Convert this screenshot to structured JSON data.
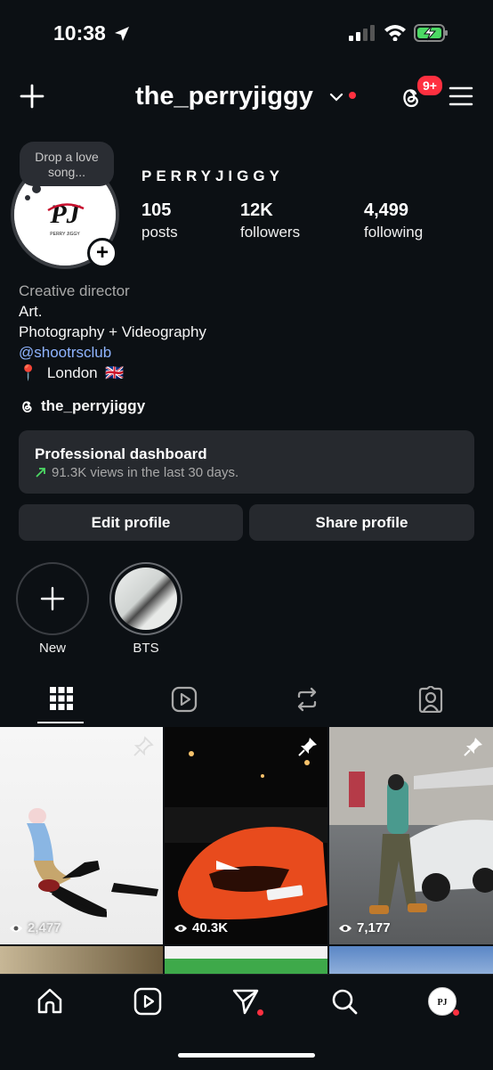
{
  "status_bar": {
    "time": "10:38"
  },
  "header": {
    "username": "the_perryjiggy",
    "notification_badge": "9+"
  },
  "profile": {
    "note": "Drop a love song...",
    "display_name": "PERRYJIGGY",
    "avatar_logo_text": "PJ",
    "avatar_logo_sub": "PERRY JIGGY",
    "stats": [
      {
        "value": "105",
        "label": "posts"
      },
      {
        "value": "12K",
        "label": "followers"
      },
      {
        "value": "4,499",
        "label": "following"
      }
    ],
    "bio": {
      "category": "Creative director",
      "line1": "Art.",
      "line2": "Photography + Videography",
      "mention": "@shootrsclub",
      "location": "London",
      "location_pin": "📍",
      "location_flag": "🇬🇧"
    },
    "threads_handle": "the_perryjiggy"
  },
  "dashboard": {
    "title": "Professional dashboard",
    "subtitle": "91.3K views in the last 30 days."
  },
  "buttons": {
    "edit": "Edit profile",
    "share": "Share profile"
  },
  "highlights": [
    {
      "label": "New"
    },
    {
      "label": "BTS"
    }
  ],
  "tabs": [
    "grid-icon",
    "reels-icon",
    "reposts-icon",
    "tagged-icon"
  ],
  "posts": [
    {
      "views": "2,477",
      "pinned": true
    },
    {
      "views": "40.3K",
      "pinned": true
    },
    {
      "views": "7,177",
      "pinned": true
    }
  ],
  "nav": [
    "home-icon",
    "reels-icon",
    "messages-icon",
    "search-icon",
    "profile-avatar"
  ],
  "colors": {
    "background": "#0c1014",
    "card": "#26292e",
    "accent_red": "#ff3040",
    "link": "#8fb4ff"
  }
}
